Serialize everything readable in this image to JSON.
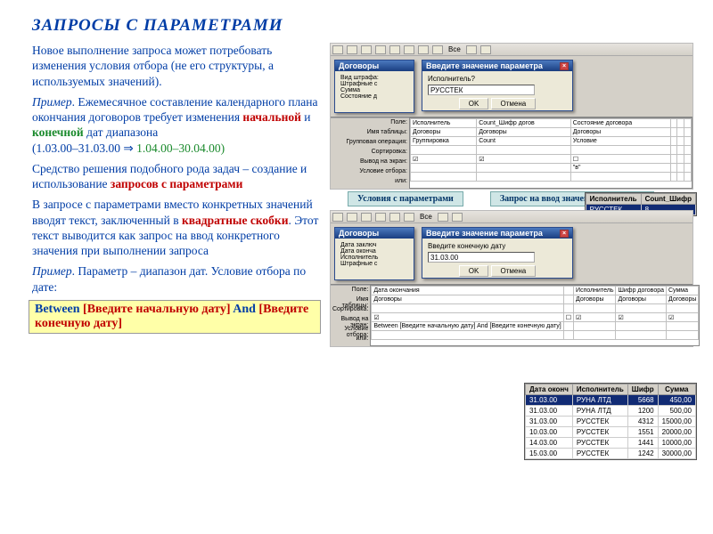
{
  "title": "ЗАПРОСЫ С ПАРАМЕТРАМИ",
  "para1": "Новое выполнение запроса может потребовать изменения условия отбора (не его структуры, а используемых значений).",
  "para2_label": "Пример",
  "para2_a": ". Ежемесячное составление календарного плана окончания договоров требует изменения ",
  "para2_start": "начальной",
  "para2_and": " и ",
  "para2_end": "конечной",
  "para2_tail": " дат диапазона",
  "para2_range_a": "(1.03.00–31.03.00 ",
  "para2_arrow": "⇒",
  "para2_range_b": " 1.04.00–30.04.00)",
  "para3_a": "Средство решения подобного рода задач – создание и использование ",
  "para3_b": "запросов с параметрами",
  "para4_a": "В запросе с параметрами вместо конкретных значений вводят текст, заключенный в ",
  "para4_b": "квадратные скобки",
  "para4_c": ". Этот текст выводится как запрос на ввод конкретного значения при выполнении запроса",
  "para5_label": "Пример",
  "para5_a": ". Параметр – диапазон дат. Условие отбора по дате:",
  "between_k1": "Between ",
  "between_p1": "[Введите начальную дату]",
  "between_k2": " And ",
  "between_p2": "[Введите конечную дату]",
  "label1": "Условия с параметрами",
  "label2": "Запрос на ввод значения параметра",
  "toolbar_text": "Все",
  "dlg1": {
    "title": "Введите значение параметра",
    "label": "Исполнитель?",
    "value": "РУССТЕК",
    "ok": "OK",
    "cancel": "Отмена"
  },
  "dlg2": {
    "title": "Введите значение параметра",
    "label": "Введите конечную дату",
    "value": "31.03.00",
    "ok": "OK",
    "cancel": "Отмена"
  },
  "side_win1": "Договоры",
  "side_labels1": [
    "Вид штрафа:",
    "Штрафные с",
    "Сумма",
    "Состояние д"
  ],
  "side_win2": "Договоры",
  "side_labels2": [
    "Дата заключ",
    "Дата оконча",
    "Исполнитель",
    "Штрафные с"
  ],
  "design1": {
    "row_labels": [
      "Поле:",
      "Имя таблицы:",
      "Групповая операция:",
      "Сортировка:",
      "Вывод на экран:",
      "Условие отбора:",
      "или:"
    ],
    "cols": [
      "Исполнитель",
      "Count_Шифр догов",
      "Состояние договора"
    ],
    "t_rows": [
      "Договоры",
      "Договоры",
      "Договоры"
    ],
    "ops": [
      "Группировка",
      "Count",
      "Условие"
    ],
    "cond": "\"в\""
  },
  "design2": {
    "row_labels": [
      "Поле:",
      "Имя таблицы:",
      "Сортировка:",
      "Вывод на экран:",
      "Условие отбора:",
      "или:"
    ],
    "cols": [
      "Дата окончания",
      "",
      "Исполнитель",
      "Шифр договора",
      "Сумма"
    ],
    "cond": "Between [Введите начальную дату] And [Введите конечную дату]"
  },
  "result1": {
    "headers": [
      "Исполнитель",
      "Count_Шифр"
    ],
    "rows": [
      [
        "РУССТЕК",
        "8"
      ]
    ]
  },
  "result2": {
    "headers": [
      "Дата оконч",
      "Исполнитель",
      "Шифр",
      "Сумма"
    ],
    "rows": [
      [
        "31.03.00",
        "РУНА ЛТД",
        "5668",
        "450,00"
      ],
      [
        "31.03.00",
        "РУНА ЛТД",
        "1200",
        "500,00"
      ],
      [
        "31.03.00",
        "РУССТЕК",
        "4312",
        "15000,00"
      ],
      [
        "10.03.00",
        "РУССТЕК",
        "1551",
        "20000,00"
      ],
      [
        "14.03.00",
        "РУССТЕК",
        "1441",
        "10000,00"
      ],
      [
        "15.03.00",
        "РУССТЕК",
        "1242",
        "30000,00"
      ]
    ]
  }
}
